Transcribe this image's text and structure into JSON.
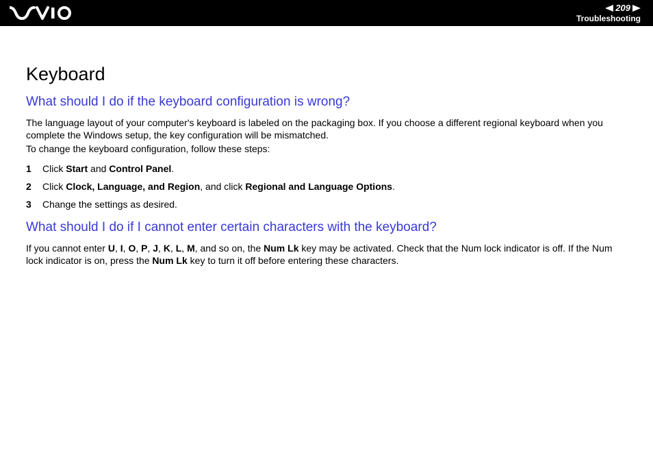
{
  "header": {
    "page_number": "209",
    "section": "Troubleshooting"
  },
  "title": "Keyboard",
  "sections": [
    {
      "heading": "What should I do if the keyboard configuration is wrong?",
      "paras": [
        "The language layout of your computer's keyboard is labeled on the packaging box. If you choose a different regional keyboard when you complete the Windows setup, the key configuration will be mismatched.",
        "To change the keyboard configuration, follow these steps:"
      ],
      "steps": [
        {
          "num": "1",
          "pre": "Click ",
          "b1": "Start",
          "mid1": " and ",
          "b2": "Control Panel",
          "post": "."
        },
        {
          "num": "2",
          "pre": "Click ",
          "b1": "Clock, Language, and Region",
          "mid1": ", and click ",
          "b2": "Regional and Language Options",
          "post": "."
        },
        {
          "num": "3",
          "pre": "Change the settings as desired.",
          "b1": "",
          "mid1": "",
          "b2": "",
          "post": ""
        }
      ]
    },
    {
      "heading": "What should I do if I cannot enter certain characters with the keyboard?",
      "body": {
        "t1": "If you cannot enter ",
        "k1": "U",
        "c1": ", ",
        "k2": "I",
        "c2": ", ",
        "k3": "O",
        "c3": ", ",
        "k4": "P",
        "c4": ", ",
        "k5": "J",
        "c5": ", ",
        "k6": "K",
        "c6": ", ",
        "k7": "L",
        "c7": ", ",
        "k8": "M",
        "t2": ", and so on, the ",
        "numlk1": "Num Lk",
        "t3": " key may be activated. Check that the Num lock indicator is off. If the Num lock indicator is on, press the ",
        "numlk2": "Num Lk",
        "t4": " key to turn it off before entering these characters."
      }
    }
  ]
}
